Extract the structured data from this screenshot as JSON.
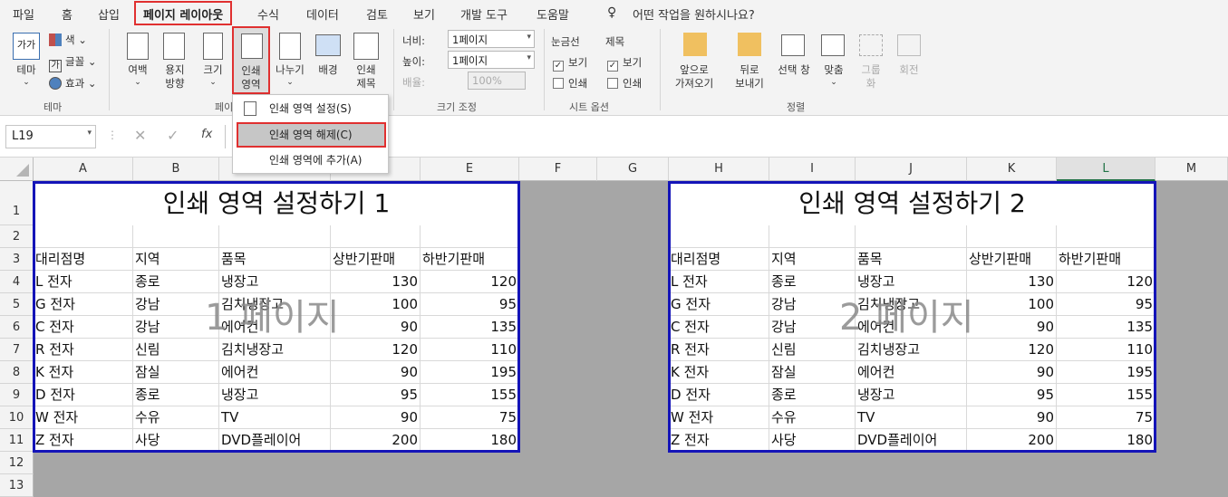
{
  "tabs": [
    "파일",
    "홈",
    "삽입",
    "페이지 레이아웃",
    "수식",
    "데이터",
    "검토",
    "보기",
    "개발 도구",
    "도움말"
  ],
  "tell_me": "어떤 작업을 원하시나요?",
  "ribbon": {
    "theme": {
      "theme_btn": "테마",
      "colors": "색",
      "fonts": "글꼴",
      "effects": "효과",
      "group": "테마"
    },
    "page_setup": {
      "margins": "여백",
      "orientation": "용지\n방향",
      "size": "크기",
      "print_area": "인쇄\n영역",
      "breaks": "나누기",
      "background": "배경",
      "print_titles": "인쇄\n제목",
      "group": "페이지 설정"
    },
    "scale": {
      "width_label": "너비:",
      "width_value": "1페이지",
      "height_label": "높이:",
      "height_value": "1페이지",
      "scale_label": "배율:",
      "scale_value": "100%",
      "group": "크기 조정"
    },
    "sheet_options": {
      "gridlines": "눈금선",
      "headings": "제목",
      "view": "보기",
      "print": "인쇄",
      "group": "시트 옵션"
    },
    "arrange": {
      "bring_forward": "앞으로\n가져오기",
      "send_backward": "뒤로\n보내기",
      "selection_pane": "선택 창",
      "align": "맞춤",
      "group_btn": "그룹\n화",
      "rotate": "회전",
      "group": "정렬"
    }
  },
  "dropdown": {
    "set": "인쇄 영역 설정(S)",
    "clear": "인쇄 영역 해제(C)",
    "add": "인쇄 영역에 추가(A)"
  },
  "name_box": "L19",
  "fx": "fx",
  "columns": [
    "A",
    "B",
    "C",
    "D",
    "E",
    "F",
    "G",
    "H",
    "I",
    "J",
    "K",
    "L",
    "M"
  ],
  "rows": [
    "1",
    "2",
    "3",
    "4",
    "5",
    "6",
    "7",
    "8",
    "9",
    "10",
    "11",
    "12",
    "13"
  ],
  "table1": {
    "title": "인쇄 영역 설정하기 1",
    "watermark": "1 페이지",
    "headers": [
      "대리점명",
      "지역",
      "품목",
      "상반기판매",
      "하반기판매"
    ],
    "rows": [
      [
        "L 전자",
        "종로",
        "냉장고",
        "130",
        "120"
      ],
      [
        "G 전자",
        "강남",
        "김치냉장고",
        "100",
        "95"
      ],
      [
        "C 전자",
        "강남",
        "에어컨",
        "90",
        "135"
      ],
      [
        "R 전자",
        "신림",
        "김치냉장고",
        "120",
        "110"
      ],
      [
        "K 전자",
        "잠실",
        "에어컨",
        "90",
        "195"
      ],
      [
        "D 전자",
        "종로",
        "냉장고",
        "95",
        "155"
      ],
      [
        "W 전자",
        "수유",
        "TV",
        "90",
        "75"
      ],
      [
        "Z 전자",
        "사당",
        "DVD플레이어",
        "200",
        "180"
      ]
    ]
  },
  "table2": {
    "title": "인쇄 영역 설정하기 2",
    "watermark": "2 페이지",
    "headers": [
      "대리점명",
      "지역",
      "품목",
      "상반기판매",
      "하반기판매"
    ],
    "rows": [
      [
        "L 전자",
        "종로",
        "냉장고",
        "130",
        "120"
      ],
      [
        "G 전자",
        "강남",
        "김치냉장고",
        "100",
        "95"
      ],
      [
        "C 전자",
        "강남",
        "에어컨",
        "90",
        "135"
      ],
      [
        "R 전자",
        "신림",
        "김치냉장고",
        "120",
        "110"
      ],
      [
        "K 전자",
        "잠실",
        "에어컨",
        "90",
        "195"
      ],
      [
        "D 전자",
        "종로",
        "냉장고",
        "95",
        "155"
      ],
      [
        "W 전자",
        "수유",
        "TV",
        "90",
        "75"
      ],
      [
        "Z 전자",
        "사당",
        "DVD플레이어",
        "200",
        "180"
      ]
    ]
  },
  "colors": {
    "accent_red": "#e03030",
    "page_border": "#1414b8",
    "excel_green": "#217346"
  }
}
